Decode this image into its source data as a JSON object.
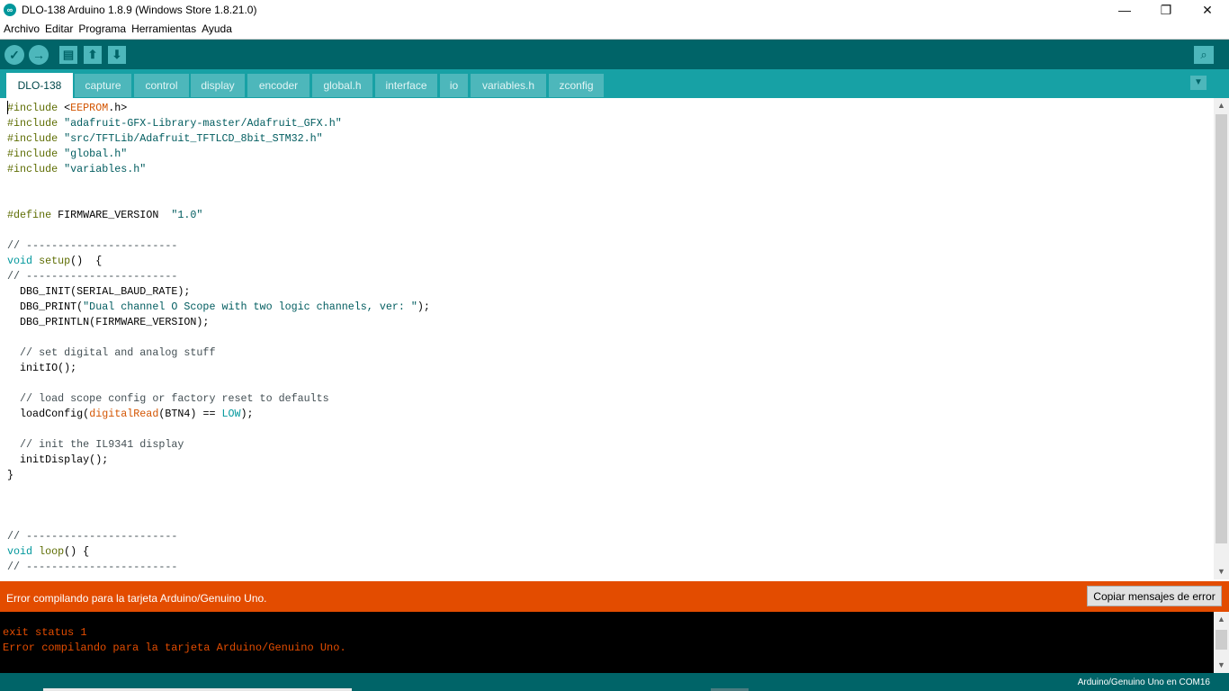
{
  "window": {
    "title": "DLO-138 Arduino 1.8.9 (Windows Store 1.8.21.0)",
    "controls": [
      "—",
      "❐",
      "✕"
    ]
  },
  "menu": [
    "Archivo",
    "Editar",
    "Programa",
    "Herramientas",
    "Ayuda"
  ],
  "toolbar": {
    "verify": "✓",
    "upload": "→",
    "new": "▤",
    "open": "⬆",
    "save": "⬇",
    "serial_monitor": "⌕"
  },
  "tabs": [
    "DLO-138",
    "capture",
    "control",
    "display",
    "encoder",
    "global.h",
    "interface",
    "io",
    "variables.h",
    "zconfig"
  ],
  "tab_menu": "▼",
  "status": {
    "message": "Error compilando para la tarjeta Arduino/Genuino Uno.",
    "copy_button": "Copiar mensajes de error"
  },
  "console": {
    "lines": [
      "exit status 1",
      "Error compilando para la tarjeta Arduino/Genuino Uno."
    ]
  },
  "footer": {
    "board": "Arduino/Genuino Uno en COM16"
  },
  "colors": {
    "toolbar": "#006468",
    "tabbar": "#17a1a5",
    "tab": "#4db7bb",
    "error_bar": "#e34c00",
    "console_bg": "#000000"
  },
  "icons": {
    "app": "arduino-logo-icon",
    "verify": "check-icon",
    "upload": "arrow-right-icon",
    "new": "new-file-icon",
    "open": "open-icon",
    "save": "save-icon",
    "serial": "serial-monitor-icon"
  }
}
